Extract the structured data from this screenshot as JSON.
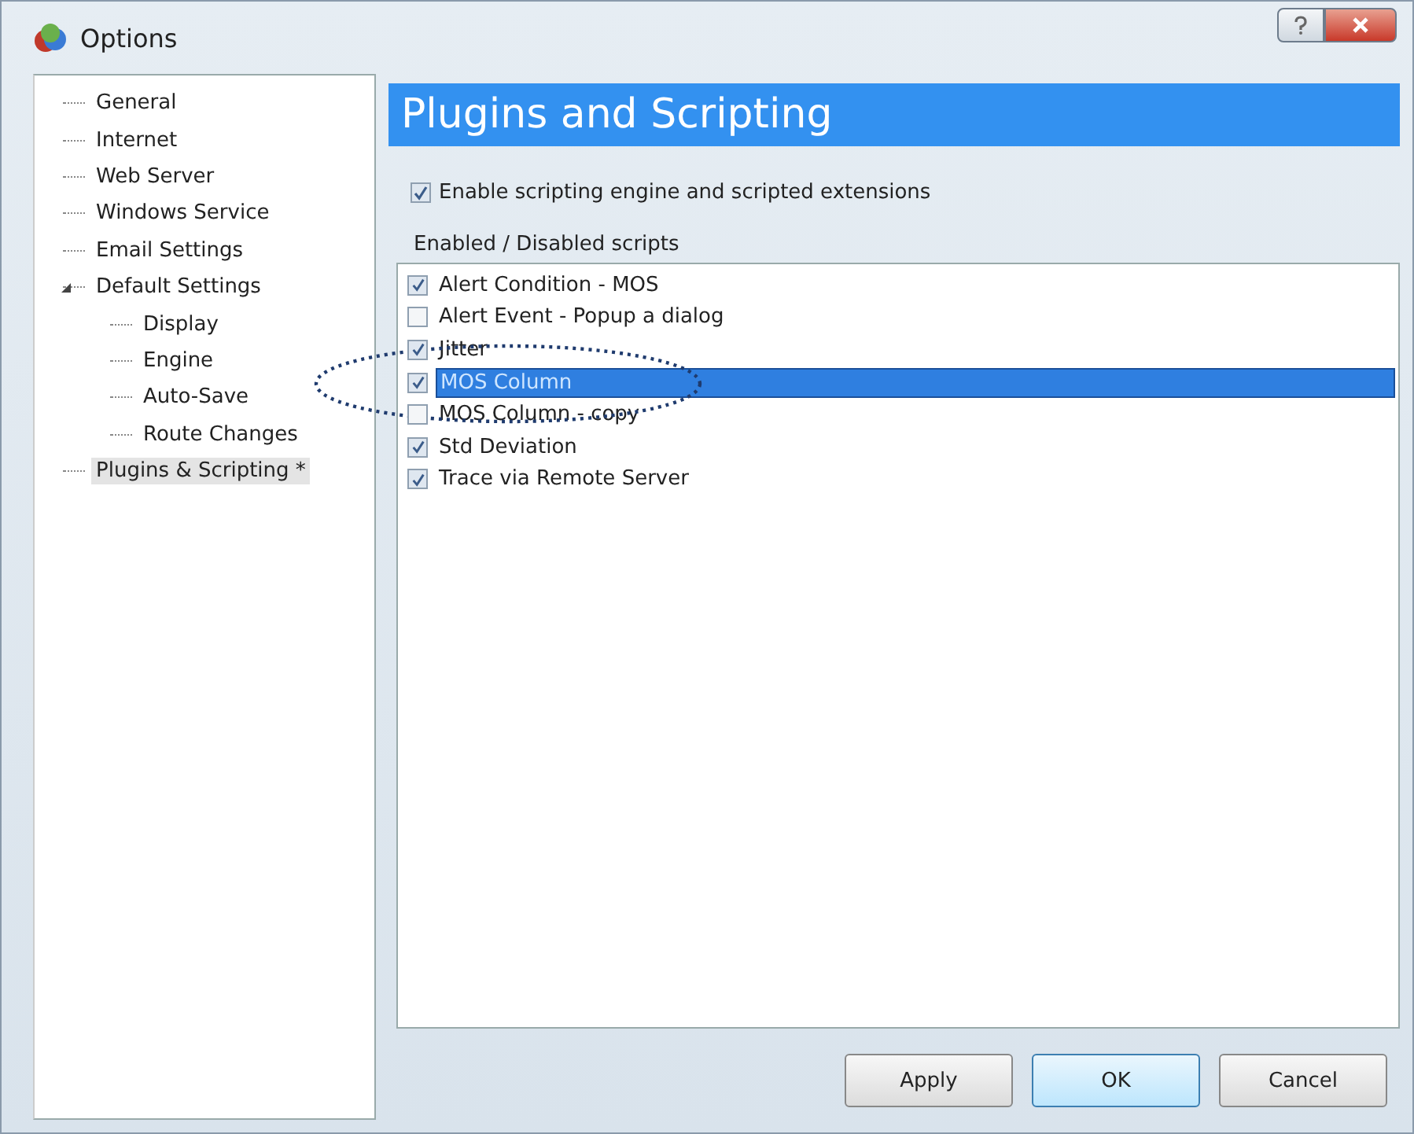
{
  "window": {
    "title": "Options"
  },
  "tree": [
    {
      "label": "General",
      "selected": false
    },
    {
      "label": "Internet",
      "selected": false
    },
    {
      "label": "Web Server",
      "selected": false
    },
    {
      "label": "Windows Service",
      "selected": false
    },
    {
      "label": "Email Settings",
      "selected": false
    },
    {
      "label": "Default Settings",
      "selected": false,
      "expanded": true,
      "children": [
        {
          "label": "Display",
          "selected": false
        },
        {
          "label": "Engine",
          "selected": false
        },
        {
          "label": "Auto-Save",
          "selected": false
        },
        {
          "label": "Route Changes",
          "selected": false
        }
      ]
    },
    {
      "label": "Plugins & Scripting *",
      "selected": true
    }
  ],
  "header": "Plugins and Scripting",
  "enable_option": {
    "label": "Enable scripting engine and scripted extensions",
    "checked": true
  },
  "scripts_label": "Enabled / Disabled scripts",
  "scripts": [
    {
      "label": "Alert Condition - MOS",
      "checked": true,
      "selected": false
    },
    {
      "label": "Alert Event - Popup a dialog",
      "checked": false,
      "selected": false
    },
    {
      "label": "Jitter",
      "checked": true,
      "selected": false
    },
    {
      "label": "MOS Column",
      "checked": true,
      "selected": true
    },
    {
      "label": "MOS Column - copy",
      "checked": false,
      "selected": false
    },
    {
      "label": "Std Deviation",
      "checked": true,
      "selected": false
    },
    {
      "label": "Trace via Remote Server",
      "checked": true,
      "selected": false
    }
  ],
  "buttons": [
    {
      "label": "Apply",
      "default": false
    },
    {
      "label": "OK",
      "default": true
    },
    {
      "label": "Cancel",
      "default": false
    }
  ]
}
